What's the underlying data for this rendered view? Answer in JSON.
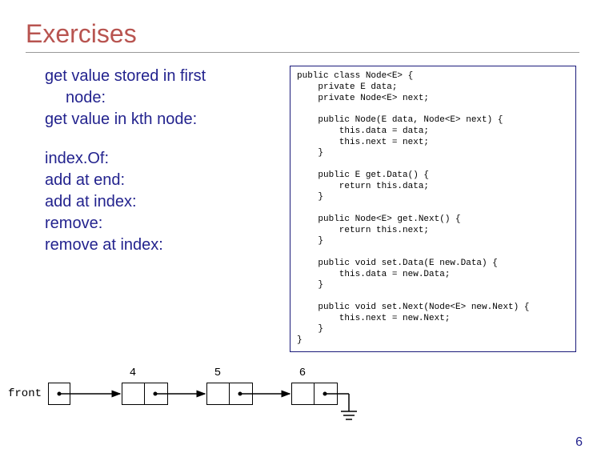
{
  "title": "Exercises",
  "bullets": {
    "b1": "get value stored in first",
    "b1b": "node:",
    "b2": "get value in kth node:",
    "b3": "index.Of:",
    "b4": "add at end:",
    "b5": "add at index:",
    "b6": "remove:",
    "b7": "remove at index:"
  },
  "code": "public class Node<E> {\n    private E data;\n    private Node<E> next;\n\n    public Node(E data, Node<E> next) {\n        this.data = data;\n        this.next = next;\n    }\n\n    public E get.Data() {\n        return this.data;\n    }\n\n    public Node<E> get.Next() {\n        return this.next;\n    }\n\n    public void set.Data(E new.Data) {\n        this.data = new.Data;\n    }\n\n    public void set.Next(Node<E> new.Next) {\n        this.next = new.Next;\n    }\n}",
  "diagram": {
    "front_label": "front",
    "nodes": [
      "4",
      "5",
      "6"
    ]
  },
  "page_number": "6"
}
